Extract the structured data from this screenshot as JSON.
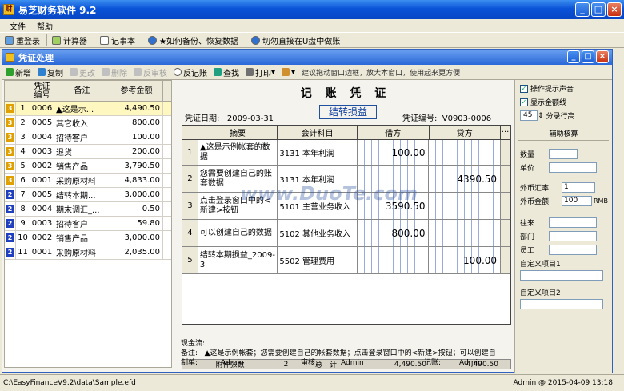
{
  "app": {
    "title": "易芝财务软件 9.2"
  },
  "menu": [
    "文件",
    "帮助"
  ],
  "toolbar1": [
    "重登录",
    "计算器",
    "记事本",
    "★如何备份、恢复数据",
    "切勿直接在U盘中做账"
  ],
  "inner": {
    "title": "凭证处理"
  },
  "toolbar2": {
    "items": [
      {
        "label": "新增",
        "enabled": true
      },
      {
        "label": "复制",
        "enabled": true
      },
      {
        "label": "更改",
        "enabled": false
      },
      {
        "label": "删除",
        "enabled": false
      },
      {
        "label": "反审核",
        "enabled": false
      },
      {
        "label": "反记账",
        "enabled": true
      },
      {
        "label": "查找",
        "enabled": true
      },
      {
        "label": "打印",
        "enabled": true
      }
    ],
    "hint": "建议拖动窗口边框，放大本窗口，使用起来更方便"
  },
  "list": {
    "headers": [
      "凭证编号",
      "备注",
      "参考金额"
    ],
    "rows": [
      {
        "badge": "3",
        "n": "1",
        "no": "0006",
        "memo": "▲这是示...",
        "amt": "4,490.50",
        "sel": true
      },
      {
        "badge": "3",
        "n": "2",
        "no": "0005",
        "memo": "其它收入",
        "amt": "800.00"
      },
      {
        "badge": "3",
        "n": "3",
        "no": "0004",
        "memo": "招待客户",
        "amt": "100.00"
      },
      {
        "badge": "3",
        "n": "4",
        "no": "0003",
        "memo": "退货",
        "amt": "200.00"
      },
      {
        "badge": "3",
        "n": "5",
        "no": "0002",
        "memo": "销售产品",
        "amt": "3,790.50"
      },
      {
        "badge": "3",
        "n": "6",
        "no": "0001",
        "memo": "采购原材料",
        "amt": "4,833.00"
      },
      {
        "badge": "2",
        "n": "7",
        "no": "0005",
        "memo": "结转本期...",
        "amt": "3,000.00"
      },
      {
        "badge": "2",
        "n": "8",
        "no": "0004",
        "memo": "期末调汇_...",
        "amt": "0.50"
      },
      {
        "badge": "2",
        "n": "9",
        "no": "0003",
        "memo": "招待客户",
        "amt": "59.80"
      },
      {
        "badge": "2",
        "n": "10",
        "no": "0002",
        "memo": "销售产品",
        "amt": "3,000.00"
      },
      {
        "badge": "2",
        "n": "11",
        "no": "0001",
        "memo": "采购原材料",
        "amt": "2,035.00"
      }
    ]
  },
  "voucher": {
    "title": "记 账 凭 证",
    "type": "结转损益",
    "date_label": "凭证日期:",
    "date": "2009-03-31",
    "no_label": "凭证编号:",
    "no": "V0903-0006",
    "headers": [
      "摘要",
      "会计科目",
      "借方",
      "贷方"
    ],
    "rows": [
      {
        "n": "1",
        "memo": "▲这是示例帐套的数据",
        "acct": "3131 本年利润",
        "debit": "100.00",
        "credit": ""
      },
      {
        "n": "2",
        "memo": "您需要创建自己的账套数据",
        "acct": "3131 本年利润",
        "debit": "",
        "credit": "4390.50"
      },
      {
        "n": "3",
        "memo": "点击登录窗口中的<新建>按钮",
        "acct": "5101 主营业务收入",
        "debit": "3590.50",
        "credit": ""
      },
      {
        "n": "4",
        "memo": "可以创建自己的数据",
        "acct": "5102 其他业务收入",
        "debit": "800.00",
        "credit": ""
      },
      {
        "n": "5",
        "memo": "结转本期损益_2009-3",
        "acct": "5502 管理费用",
        "debit": "",
        "credit": "100.00"
      }
    ],
    "footer": {
      "att_label": "附件张数",
      "att": "2",
      "total_label": "总　计",
      "debit_total": "4,490.50",
      "credit_total": "4,490.50"
    },
    "cash_label": "现金流:",
    "note_label": "备注:",
    "note": "▲这是示例帐套；您需要创建自己的帐套数据；点击登录窗口中的<新建>按钮；可以创建自",
    "maker_label": "制单:",
    "maker": "Admin",
    "auditor_label": "审核:",
    "auditor": "Admin",
    "poster_label": "记账:",
    "poster": "Admin"
  },
  "rpanel": {
    "sound": "操作提示声音",
    "showamt": "显示金额线",
    "rowh": "45",
    "rowh_label": "分录行高",
    "aux_title": "辅助核算",
    "qty": "数量",
    "price": "单价",
    "fx_rate": "外币汇率",
    "fx_rate_val": "1",
    "fx_amt": "外币金额",
    "fx_amt_val": "100",
    "fx_cur": "RMB",
    "come": "往来",
    "dept": "部门",
    "staff": "员工",
    "custom1": "自定义项目1",
    "custom2": "自定义项目2"
  },
  "status": {
    "path": "C:\\EasyFinanceV9.2\\data\\Sample.efd",
    "right": "Admin @ 2015-04-09 13:18"
  },
  "watermark": "www.DuoTe.com"
}
